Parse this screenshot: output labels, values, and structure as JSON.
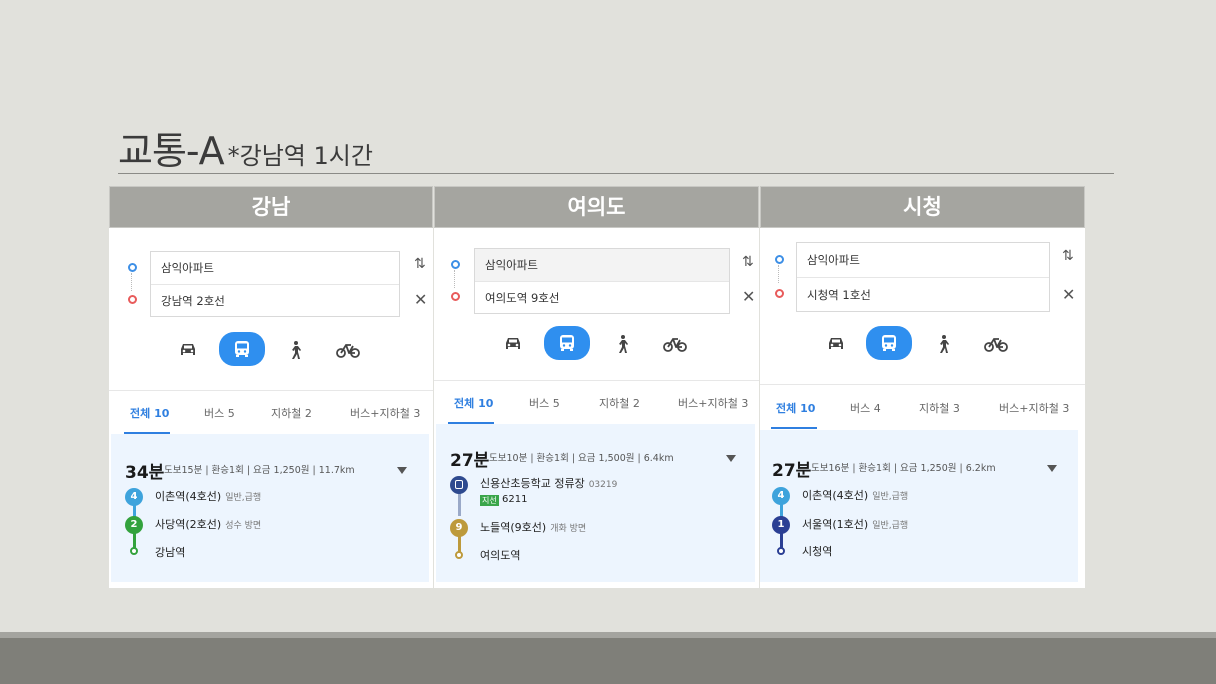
{
  "title": {
    "main": "교통-A",
    "sub": "*강남역 1시간"
  },
  "panels": [
    {
      "header": "강남",
      "origin": "삼익아파트",
      "destination": "강남역 2호선",
      "tabs": [
        "전체 10",
        "버스 5",
        "지하철 2",
        "버스+지하철 3"
      ],
      "time": "34분",
      "meta": "도보15분 | 환승1회 | 요금 1,250원 | 11.7km",
      "legs": [
        {
          "badge": "4",
          "color": "#3ea3dc",
          "station": "이촌역(4호선)",
          "dir": "일반,급행"
        },
        {
          "badge": "2",
          "color": "#33a23d",
          "station": "사당역(2호선)",
          "dir": "성수 방면"
        }
      ],
      "end": "강남역"
    },
    {
      "header": "여의도",
      "origin": "삼익아파트",
      "destination": "여의도역 9호선",
      "tabs": [
        "전체 10",
        "버스 5",
        "지하철 2",
        "버스+지하철 3"
      ],
      "time": "27분",
      "meta": "도보10분 | 환승1회 | 요금 1,500원 | 6.4km",
      "bus_stop": "신용산초등학교 정류장",
      "bus_stop_id": "03219",
      "bus_tag": "지선",
      "bus_number": "6211",
      "legs": [
        {
          "badge": "9",
          "color": "#bd9a3c",
          "station": "노들역(9호선)",
          "dir": "개화 방면"
        }
      ],
      "end": "여의도역"
    },
    {
      "header": "시청",
      "origin": "삼익아파트",
      "destination": "시청역 1호선",
      "tabs": [
        "전체 10",
        "버스 4",
        "지하철 3",
        "버스+지하철 3"
      ],
      "time": "27분",
      "meta": "도보16분 | 환승1회 | 요금 1,250원 | 6.2km",
      "legs": [
        {
          "badge": "4",
          "color": "#3ea3dc",
          "station": "이촌역(4호선)",
          "dir": "일반,급행"
        },
        {
          "badge": "1",
          "color": "#2b3f94",
          "station": "서울역(1호선)",
          "dir": "일반,급행"
        }
      ],
      "end": "시청역"
    }
  ],
  "modes": [
    "car-icon",
    "bus-icon",
    "walk-icon",
    "bike-icon"
  ],
  "colors": {
    "accent": "#2f8fef",
    "header_bg": "#a5a5a0",
    "result_bg": "#edf5fe"
  }
}
